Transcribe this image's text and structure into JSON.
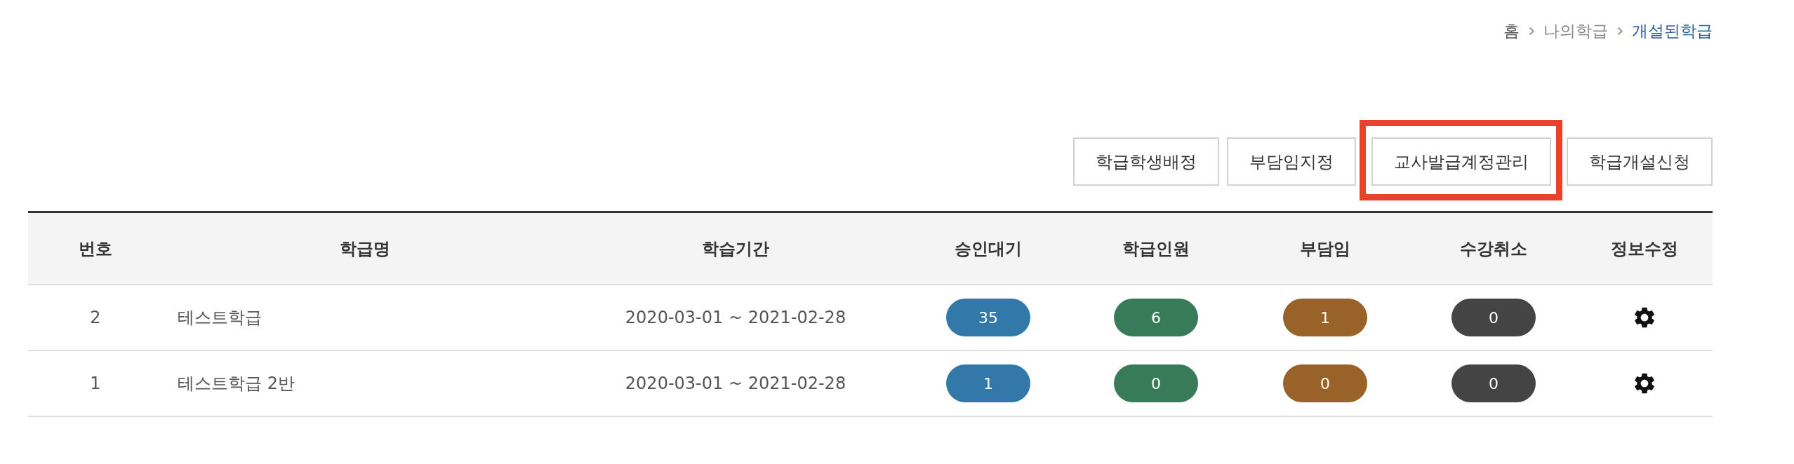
{
  "breadcrumb": [
    {
      "label": "홈",
      "kind": "home"
    },
    {
      "label": "나의학급",
      "kind": "link"
    },
    {
      "label": "개설된학급",
      "kind": "current"
    }
  ],
  "buttons": [
    {
      "label": "학급학생배정",
      "highlighted": false
    },
    {
      "label": "부담임지정",
      "highlighted": false
    },
    {
      "label": "교사발급계정관리",
      "highlighted": true
    },
    {
      "label": "학급개설신청",
      "highlighted": false
    }
  ],
  "table": {
    "columns": [
      {
        "label": "번호",
        "kind": "center"
      },
      {
        "label": "학급명",
        "kind": "left"
      },
      {
        "label": "학습기간",
        "kind": "center"
      },
      {
        "label": "승인대기",
        "kind": "badge",
        "color": "#3278a8"
      },
      {
        "label": "학급인원",
        "kind": "badge",
        "color": "#377b58"
      },
      {
        "label": "부담임",
        "kind": "badge",
        "color": "#986228"
      },
      {
        "label": "수강취소",
        "kind": "badge",
        "color": "#444444"
      },
      {
        "label": "정보수정",
        "kind": "settings"
      }
    ],
    "rows": [
      {
        "cells": [
          "2",
          "테스트학급",
          "2020-03-01 ~ 2021-02-28",
          "35",
          "6",
          "1",
          "0"
        ]
      },
      {
        "cells": [
          "1",
          "테스트학급 2반",
          "2020-03-01 ~ 2021-02-28",
          "1",
          "0",
          "0",
          "0"
        ]
      }
    ]
  }
}
